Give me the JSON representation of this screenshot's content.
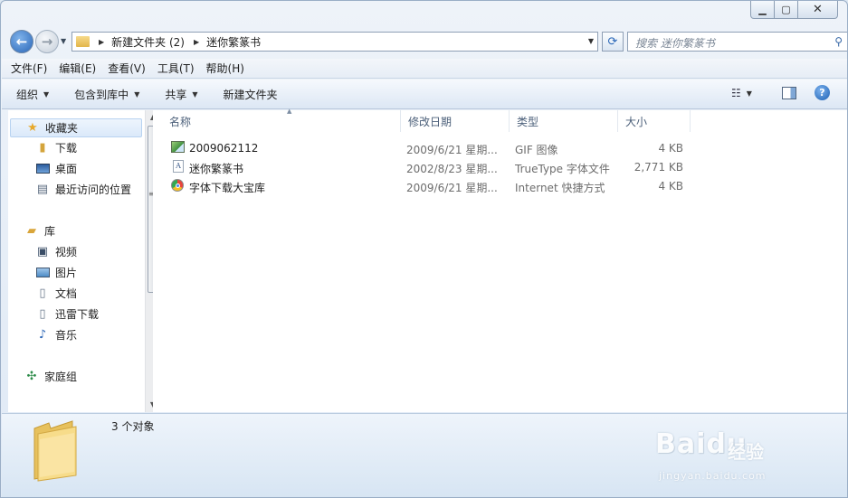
{
  "window": {
    "controls": {
      "minimize": "▁",
      "maximize": "▢",
      "close": "✕"
    }
  },
  "address": {
    "crumbs": [
      "新建文件夹 (2)",
      "迷你繁篆书"
    ],
    "search_placeholder": "搜索 迷你繁篆书"
  },
  "menu": [
    "文件(F)",
    "编辑(E)",
    "查看(V)",
    "工具(T)",
    "帮助(H)"
  ],
  "toolbar": {
    "organize": "组织",
    "include_library": "包含到库中",
    "share": "共享",
    "new_folder": "新建文件夹"
  },
  "navpane": {
    "favorites": "收藏夹",
    "downloads": "下载",
    "desktop": "桌面",
    "recent": "最近访问的位置",
    "libraries": "库",
    "videos": "视频",
    "pictures": "图片",
    "documents": "文档",
    "xunlei": "迅雷下载",
    "music": "音乐",
    "homegroup": "家庭组"
  },
  "columns": {
    "name": "名称",
    "date": "修改日期",
    "type": "类型",
    "size": "大小"
  },
  "files": [
    {
      "name": "2009062112",
      "date": "2009/6/21 星期...",
      "type": "GIF 图像",
      "size": "4 KB",
      "icon": "image-icon"
    },
    {
      "name": "迷你繁篆书",
      "date": "2002/8/23 星期...",
      "type": "TrueType 字体文件",
      "size": "2,771 KB",
      "icon": "font-file-icon"
    },
    {
      "name": "字体下载大宝库",
      "date": "2009/6/21 星期...",
      "type": "Internet 快捷方式",
      "size": "4 KB",
      "icon": "shortcut-icon"
    }
  ],
  "details": {
    "count": "3 个对象"
  },
  "watermark": {
    "brand": "Baidu",
    "sub": "经验",
    "url": "jingyan.baidu.com"
  }
}
